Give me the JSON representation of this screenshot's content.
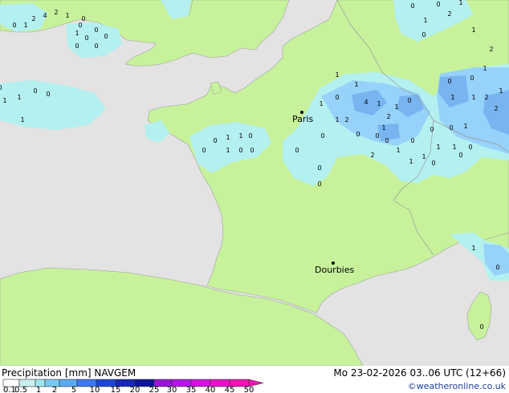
{
  "map": {
    "cities": [
      {
        "name": "Paris"
      },
      {
        "name": "Dourbies"
      }
    ],
    "values": [
      "0",
      "1",
      "2",
      "4",
      "2",
      "1",
      "0",
      "1",
      "0",
      "0",
      "0",
      "0",
      "0",
      "0",
      "0",
      "0",
      "1",
      "2",
      "1",
      "1",
      "0",
      "1",
      "1",
      "4",
      "1",
      "2",
      "1",
      "1",
      "0",
      "0",
      "1",
      "1",
      "2",
      "0",
      "0",
      "0",
      "0",
      "2",
      "1",
      "0",
      "1",
      "1",
      "0",
      "0",
      "0",
      "1",
      "1",
      "0",
      "1",
      "0",
      "0",
      "0",
      "0",
      "0",
      "0",
      "0",
      "1",
      "2",
      "1",
      "1",
      "1",
      "2",
      "2",
      "1",
      "0",
      "1",
      "1",
      "0",
      "0",
      "0",
      "0",
      "0",
      "1",
      "1",
      "1",
      "0",
      "0",
      "1",
      "0",
      "2",
      "2"
    ],
    "colors": {
      "land": "#c7f29b",
      "sea": "#e3e3e3",
      "precip_light": "#b4f0f0",
      "precip_mid": "#96d2fa",
      "precip_strong": "#78b4f0"
    }
  },
  "footer": {
    "title": "Precipitation [mm]  NAVGEM",
    "datetime": "Mo 23-02-2026 03..06 UTC (12+66)",
    "credit": "©weatheronline.co.uk",
    "scale_labels": [
      "0.1",
      "0.5",
      "1",
      "2",
      "5",
      "10",
      "15",
      "20",
      "25",
      "30",
      "35",
      "40",
      "45",
      "50"
    ],
    "scale_colors": [
      "#ffffff",
      "#c8f0f0",
      "#a0e6f0",
      "#78c8f0",
      "#5aaaf0",
      "#3c78f0",
      "#1e46d2",
      "#1428b4",
      "#0a1496",
      "#9614d2",
      "#b414e6",
      "#d214dc",
      "#e614c8",
      "#f014b4"
    ]
  }
}
